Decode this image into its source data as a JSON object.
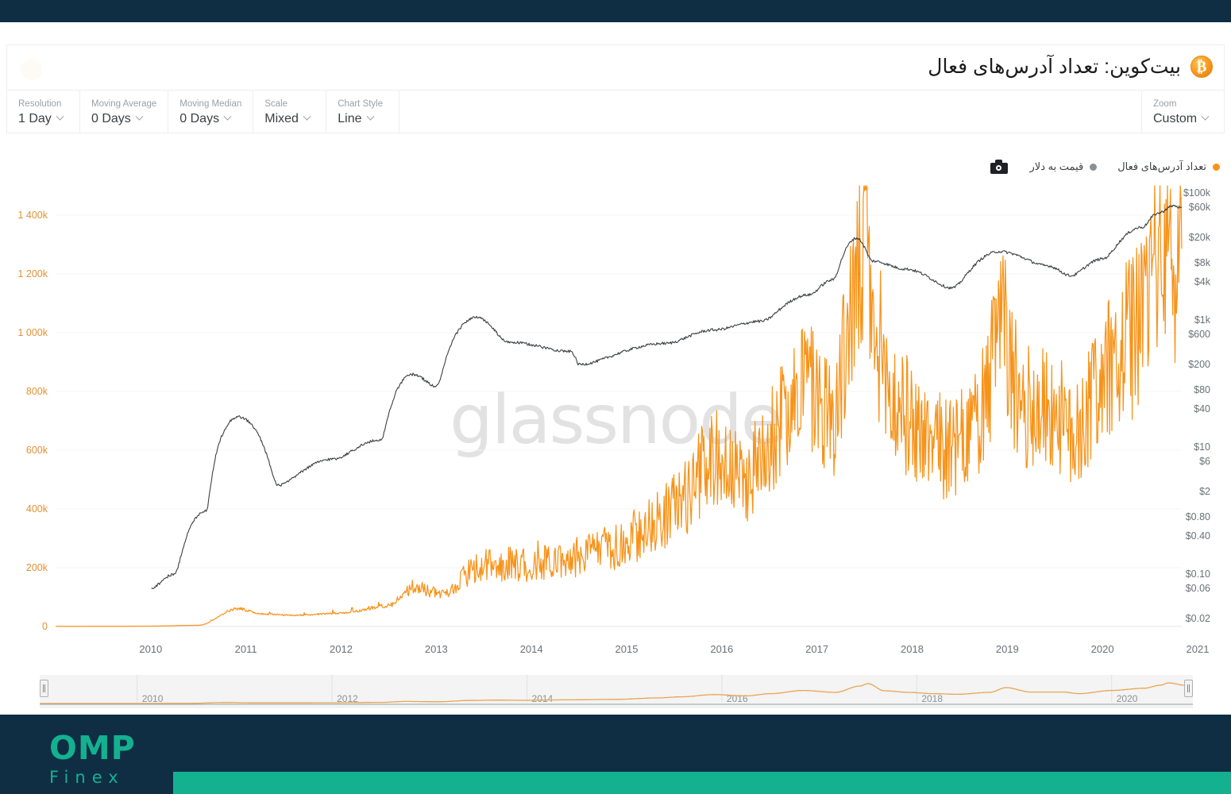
{
  "header": {
    "title": "بیت‌کوین: تعداد آدرس‌های فعال",
    "btc_icon": "bitcoin-icon",
    "btc_glyph": "₿"
  },
  "toolbar": {
    "controls": [
      {
        "label": "Resolution",
        "value": "1 Day",
        "name": "resolution"
      },
      {
        "label": "Moving Average",
        "value": "0 Days",
        "name": "moving-average"
      },
      {
        "label": "Moving Median",
        "value": "0 Days",
        "name": "moving-median"
      },
      {
        "label": "Scale",
        "value": "Mixed",
        "name": "scale"
      },
      {
        "label": "Chart Style",
        "value": "Line",
        "name": "chart-style"
      }
    ],
    "zoom": {
      "label": "Zoom",
      "value": "Custom"
    }
  },
  "legend": {
    "camera_icon": "camera-icon",
    "items": [
      {
        "text": "تعداد آدرس‌های فعال",
        "color": "#f7931a"
      },
      {
        "text": "قیمت به دلار",
        "color": "#8a8f94"
      }
    ]
  },
  "watermark": "glassnode",
  "footer": {
    "logo_top": "OMP",
    "logo_bottom": "Finex",
    "accent": "#14b191",
    "background": "#0f2e44"
  },
  "chart_data": {
    "type": "line",
    "title": "بیت‌کوین: تعداد آدرس‌های فعال",
    "xlabel": "",
    "grid": true,
    "legend_position": "top-right",
    "x_ticks": [
      "2010",
      "2011",
      "2012",
      "2013",
      "2014",
      "2015",
      "2016",
      "2017",
      "2018",
      "2019",
      "2020",
      "2021"
    ],
    "x_range": [
      "2009-07",
      "2021-05"
    ],
    "axes": {
      "left": {
        "name": "تعداد آدرس‌های فعال",
        "color": "#e09233",
        "scale": "linear",
        "ylim": [
          0,
          1500000
        ],
        "tick_labels": [
          "0",
          "200k",
          "400k",
          "600k",
          "800k",
          "1 000k",
          "1 200k",
          "1 400k"
        ],
        "tick_values": [
          0,
          200000,
          400000,
          600000,
          800000,
          1000000,
          1200000,
          1400000
        ]
      },
      "right": {
        "name": "قیمت به دلار",
        "color": "#5f6368",
        "scale": "log",
        "ylim": [
          0.015,
          130000
        ],
        "tick_labels": [
          "$100k",
          "$60k",
          "$20k",
          "$8k",
          "$4k",
          "$1k",
          "$600",
          "$200",
          "$80",
          "$40",
          "$10",
          "$6",
          "$2",
          "$0.80",
          "$0.40",
          "$0.10",
          "$0.06",
          "$0.02"
        ],
        "tick_values": [
          100000,
          60000,
          20000,
          8000,
          4000,
          1000,
          600,
          200,
          80,
          40,
          10,
          6,
          2,
          0.8,
          0.4,
          0.1,
          0.06,
          0.02
        ]
      }
    },
    "series": [
      {
        "name": "تعداد آدرس‌های فعال",
        "axis": "left",
        "color": "#f7931a",
        "points": [
          [
            "2009-07",
            200
          ],
          [
            "2010-01",
            500
          ],
          [
            "2010-07",
            1200
          ],
          [
            "2011-01",
            4000
          ],
          [
            "2011-06",
            60000
          ],
          [
            "2011-09",
            42000
          ],
          [
            "2012-01",
            38000
          ],
          [
            "2012-07",
            45000
          ],
          [
            "2013-01",
            70000
          ],
          [
            "2013-04",
            130000
          ],
          [
            "2013-08",
            110000
          ],
          [
            "2013-12",
            190000
          ],
          [
            "2014-03",
            210000
          ],
          [
            "2014-07",
            200000
          ],
          [
            "2014-12",
            230000
          ],
          [
            "2015-06",
            260000
          ],
          [
            "2015-11",
            350000
          ],
          [
            "2016-02",
            420000
          ],
          [
            "2016-06",
            560000
          ],
          [
            "2016-10",
            480000
          ],
          [
            "2017-01",
            620000
          ],
          [
            "2017-05",
            820000
          ],
          [
            "2017-09",
            700000
          ],
          [
            "2017-12",
            1100000
          ],
          [
            "2018-01",
            1250000
          ],
          [
            "2018-03",
            800000
          ],
          [
            "2018-06",
            700000
          ],
          [
            "2018-09",
            620000
          ],
          [
            "2018-12",
            580000
          ],
          [
            "2019-04",
            700000
          ],
          [
            "2019-06",
            1000000
          ],
          [
            "2019-09",
            720000
          ],
          [
            "2020-01",
            720000
          ],
          [
            "2020-03",
            620000
          ],
          [
            "2020-07",
            820000
          ],
          [
            "2020-11",
            960000
          ],
          [
            "2021-01",
            1150000
          ],
          [
            "2021-02",
            1300000
          ],
          [
            "2021-04",
            1150000
          ],
          [
            "2021-05",
            1300000
          ]
        ]
      },
      {
        "name": "قیمت به دلار",
        "axis": "right",
        "color": "#3c4043",
        "points": [
          [
            "2010-07",
            0.06
          ],
          [
            "2010-10",
            0.1
          ],
          [
            "2011-02",
            1.0
          ],
          [
            "2011-06",
            30
          ],
          [
            "2011-11",
            2.5
          ],
          [
            "2012-06",
            6.5
          ],
          [
            "2012-12",
            13
          ],
          [
            "2013-04",
            140
          ],
          [
            "2013-07",
            90
          ],
          [
            "2013-12",
            1100
          ],
          [
            "2014-04",
            450
          ],
          [
            "2014-12",
            320
          ],
          [
            "2015-01",
            200
          ],
          [
            "2015-12",
            430
          ],
          [
            "2016-06",
            700
          ],
          [
            "2016-12",
            960
          ],
          [
            "2017-06",
            2500
          ],
          [
            "2017-09",
            4300
          ],
          [
            "2017-12",
            19500
          ],
          [
            "2018-02",
            8500
          ],
          [
            "2018-06",
            6400
          ],
          [
            "2018-12",
            3200
          ],
          [
            "2019-06",
            12000
          ],
          [
            "2019-12",
            7200
          ],
          [
            "2020-03",
            5000
          ],
          [
            "2020-07",
            9200
          ],
          [
            "2020-12",
            29000
          ],
          [
            "2021-02",
            48000
          ],
          [
            "2021-04",
            63000
          ],
          [
            "2021-05",
            58000
          ]
        ]
      }
    ],
    "navigator": {
      "tick_labels": [
        "2010",
        "2012",
        "2014",
        "2016",
        "2018",
        "2020"
      ],
      "series_color": "#e8a552",
      "left_handle": "nav-handle-left",
      "right_handle": "nav-handle-right"
    }
  }
}
